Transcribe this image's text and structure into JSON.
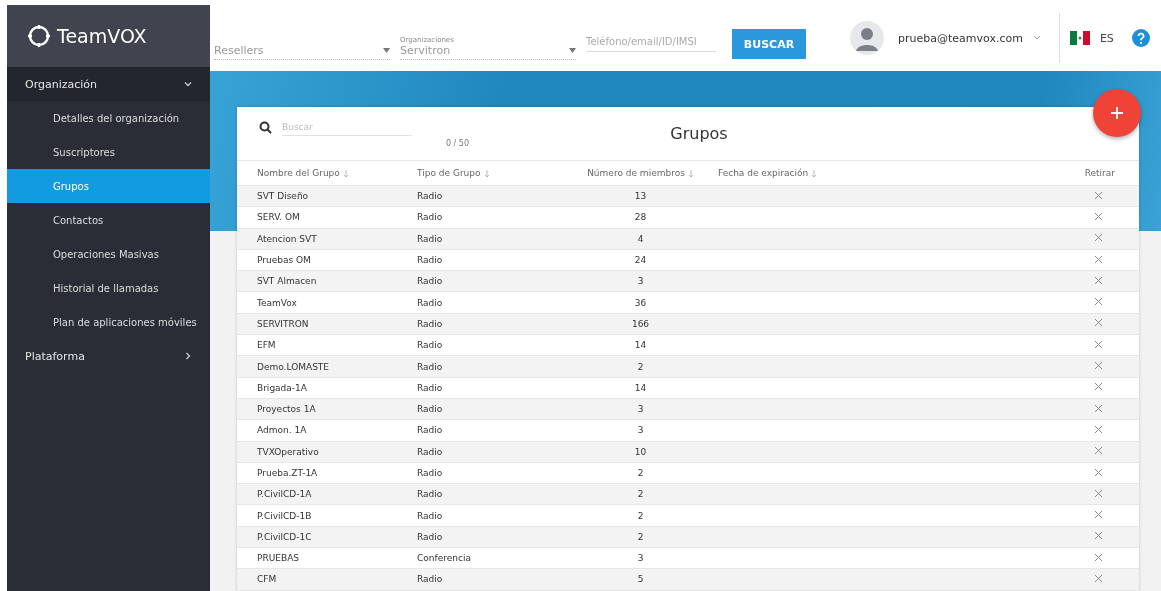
{
  "brand": {
    "name": "TeamVOX"
  },
  "topbar": {
    "reseller": {
      "value": "Resellers"
    },
    "organization": {
      "label": "Organizaciones",
      "value": "Servitron"
    },
    "search": {
      "placeholder": "Teléfono/email/ID/IMSI"
    },
    "search_button": "BUSCAR",
    "user": "prueba@teamvox.com",
    "language": "ES"
  },
  "sidebar": {
    "sections": [
      {
        "label": "Organización",
        "expanded": true,
        "items": [
          {
            "label": "Detalles del organización",
            "selected": false
          },
          {
            "label": "Suscriptores",
            "selected": false
          },
          {
            "label": "Grupos",
            "selected": true
          },
          {
            "label": "Contactos",
            "selected": false
          },
          {
            "label": "Operaciones Masivas",
            "selected": false
          },
          {
            "label": "Historial de llamadas",
            "selected": false
          },
          {
            "label": "Plan de aplicaciones móviles",
            "selected": false
          }
        ]
      },
      {
        "label": "Plataforma",
        "expanded": false
      }
    ]
  },
  "card": {
    "title": "Grupos",
    "search": {
      "placeholder": "Buscar",
      "counter": "0 / 50"
    },
    "table": {
      "columns": [
        {
          "label": "Nombre del Grupo",
          "sortable": true
        },
        {
          "label": "Tipo de Grupo",
          "sortable": true
        },
        {
          "label": "Número de miembros",
          "sortable": true
        },
        {
          "label": "Fecha de expiración",
          "sortable": true
        },
        {
          "label": "Retirar",
          "sortable": false
        }
      ],
      "rows": [
        [
          "SVT Diseño",
          "Radio",
          "13"
        ],
        [
          "SERV. OM",
          "Radio",
          "28"
        ],
        [
          "Atencion SVT",
          "Radio",
          "4"
        ],
        [
          "Pruebas OM",
          "Radio",
          "24"
        ],
        [
          "SVT Almacen",
          "Radio",
          "3"
        ],
        [
          "TeamVox",
          "Radio",
          "36"
        ],
        [
          "SERVITRON",
          "Radio",
          "166"
        ],
        [
          "EFM",
          "Radio",
          "14"
        ],
        [
          "Demo.LOMASTE",
          "Radio",
          "2"
        ],
        [
          "Brigada-1A",
          "Radio",
          "14"
        ],
        [
          "Proyectos 1A",
          "Radio",
          "3"
        ],
        [
          "Admon. 1A",
          "Radio",
          "3"
        ],
        [
          "TVXOperativo",
          "Radio",
          "10"
        ],
        [
          "Prueba.ZT-1A",
          "Radio",
          "2"
        ],
        [
          "P.CivilCD-1A",
          "Radio",
          "2"
        ],
        [
          "P.CivilCD-1B",
          "Radio",
          "2"
        ],
        [
          "P.CivilCD-1C",
          "Radio",
          "2"
        ],
        [
          "PRUEBAS",
          "Conferencia",
          "3"
        ],
        [
          "CFM",
          "Radio",
          "5"
        ]
      ]
    }
  }
}
